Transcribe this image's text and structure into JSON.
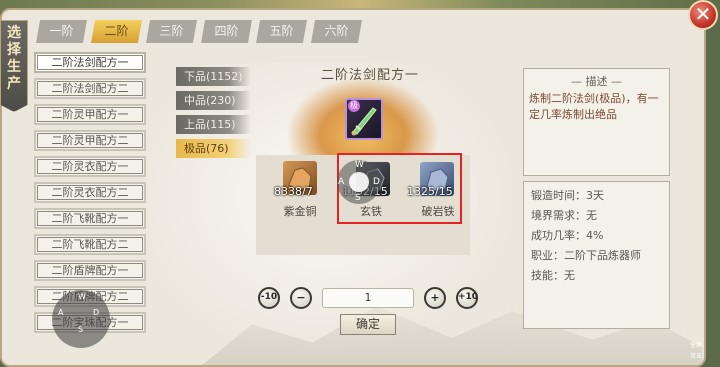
{
  "window": {
    "close_glyph": "✕"
  },
  "banner": {
    "text": "选择生产"
  },
  "tiers": [
    {
      "label": "一阶",
      "active": false
    },
    {
      "label": "二阶",
      "active": true
    },
    {
      "label": "三阶",
      "active": false
    },
    {
      "label": "四阶",
      "active": false
    },
    {
      "label": "五阶",
      "active": false
    },
    {
      "label": "六阶",
      "active": false
    }
  ],
  "recipes": [
    "二阶法剑配方一",
    "二阶法剑配方二",
    "二阶灵甲配方一",
    "二阶灵甲配方二",
    "二阶灵衣配方一",
    "二阶灵衣配方二",
    "二阶飞靴配方一",
    "二阶飞靴配方二",
    "二阶盾牌配方一",
    "二阶盾牌配方二",
    "二阶宝珠配方一"
  ],
  "grades": [
    {
      "label": "下品(1152)",
      "active": false
    },
    {
      "label": "中品(230)",
      "active": false
    },
    {
      "label": "上品(115)",
      "active": false
    },
    {
      "label": "极品(76)",
      "active": true
    }
  ],
  "recipe_title": "二阶法剑配方一",
  "product": {
    "badge": "极",
    "icon": "flying-sword-icon"
  },
  "materials": [
    {
      "name": "紫金铜",
      "count": "8338/7",
      "color": "#b27a3e"
    },
    {
      "name": "玄铁",
      "count": "1152/15",
      "color": "#3b3d44"
    },
    {
      "name": "破岩铁",
      "count": "1325/15",
      "color": "#5a6f94"
    }
  ],
  "joystick": {
    "up": "W",
    "left": "A",
    "right": "D",
    "down": "S"
  },
  "quantity": {
    "value": "1",
    "minus10": "-10",
    "minus": "−",
    "plus": "+",
    "plus10": "+10"
  },
  "confirm_label": "确定",
  "description": {
    "header": "— 描述 —",
    "text": "炼制二阶法剑(极品)，有一定几率炼制出绝品"
  },
  "info": {
    "forge_time": "锻造时间：3天",
    "realm_req": "境界需求：无",
    "success_rate": "成功几率：4%",
    "profession": "职业：二阶下品炼器师",
    "skill": "技能：无"
  },
  "float_dpad": {
    "up": "W",
    "left": "A",
    "right": "D",
    "down": "S"
  },
  "corner_labels": [
    "全屏",
    "攻击"
  ],
  "colors": {
    "tab_active": "#e6b33f",
    "grade_active": "#e8b84a",
    "highlight": "#e52323",
    "desc_text": "#7a4a33"
  }
}
